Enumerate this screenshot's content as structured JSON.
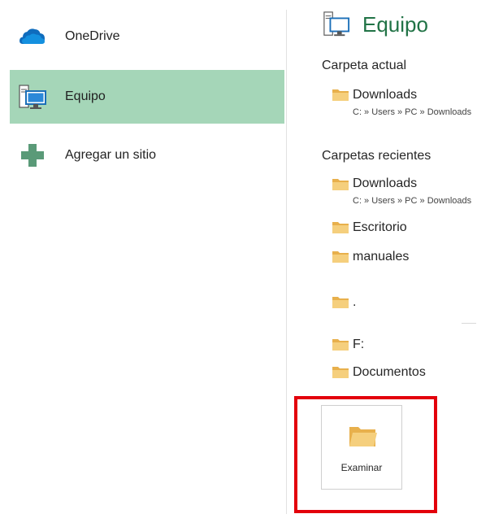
{
  "places": [
    {
      "label": "OneDrive",
      "icon": "onedrive-cloud-icon",
      "selected": false
    },
    {
      "label": "Equipo",
      "icon": "computer-icon",
      "selected": true
    },
    {
      "label": "Agregar un sitio",
      "icon": "add-plus-icon",
      "selected": false
    }
  ],
  "header": {
    "title": "Equipo",
    "icon": "computer-icon"
  },
  "current_folder": {
    "heading": "Carpeta actual",
    "items": [
      {
        "name": "Downloads",
        "path": "C: » Users » PC » Downloads"
      }
    ]
  },
  "recent_folders": {
    "heading": "Carpetas recientes",
    "items": [
      {
        "name": "Downloads",
        "path": "C: » Users » PC » Downloads"
      },
      {
        "name": "Escritorio"
      },
      {
        "name": "manuales"
      },
      {
        "name": "."
      },
      {
        "name": "F:"
      },
      {
        "name": "Documentos"
      }
    ]
  },
  "browse": {
    "label": "Examinar",
    "icon": "open-folder-icon"
  },
  "colors": {
    "accent_green": "#217346",
    "selected_bg": "#a5d6b8",
    "highlight_red": "#e3000b",
    "folder": "#f0c26a"
  }
}
